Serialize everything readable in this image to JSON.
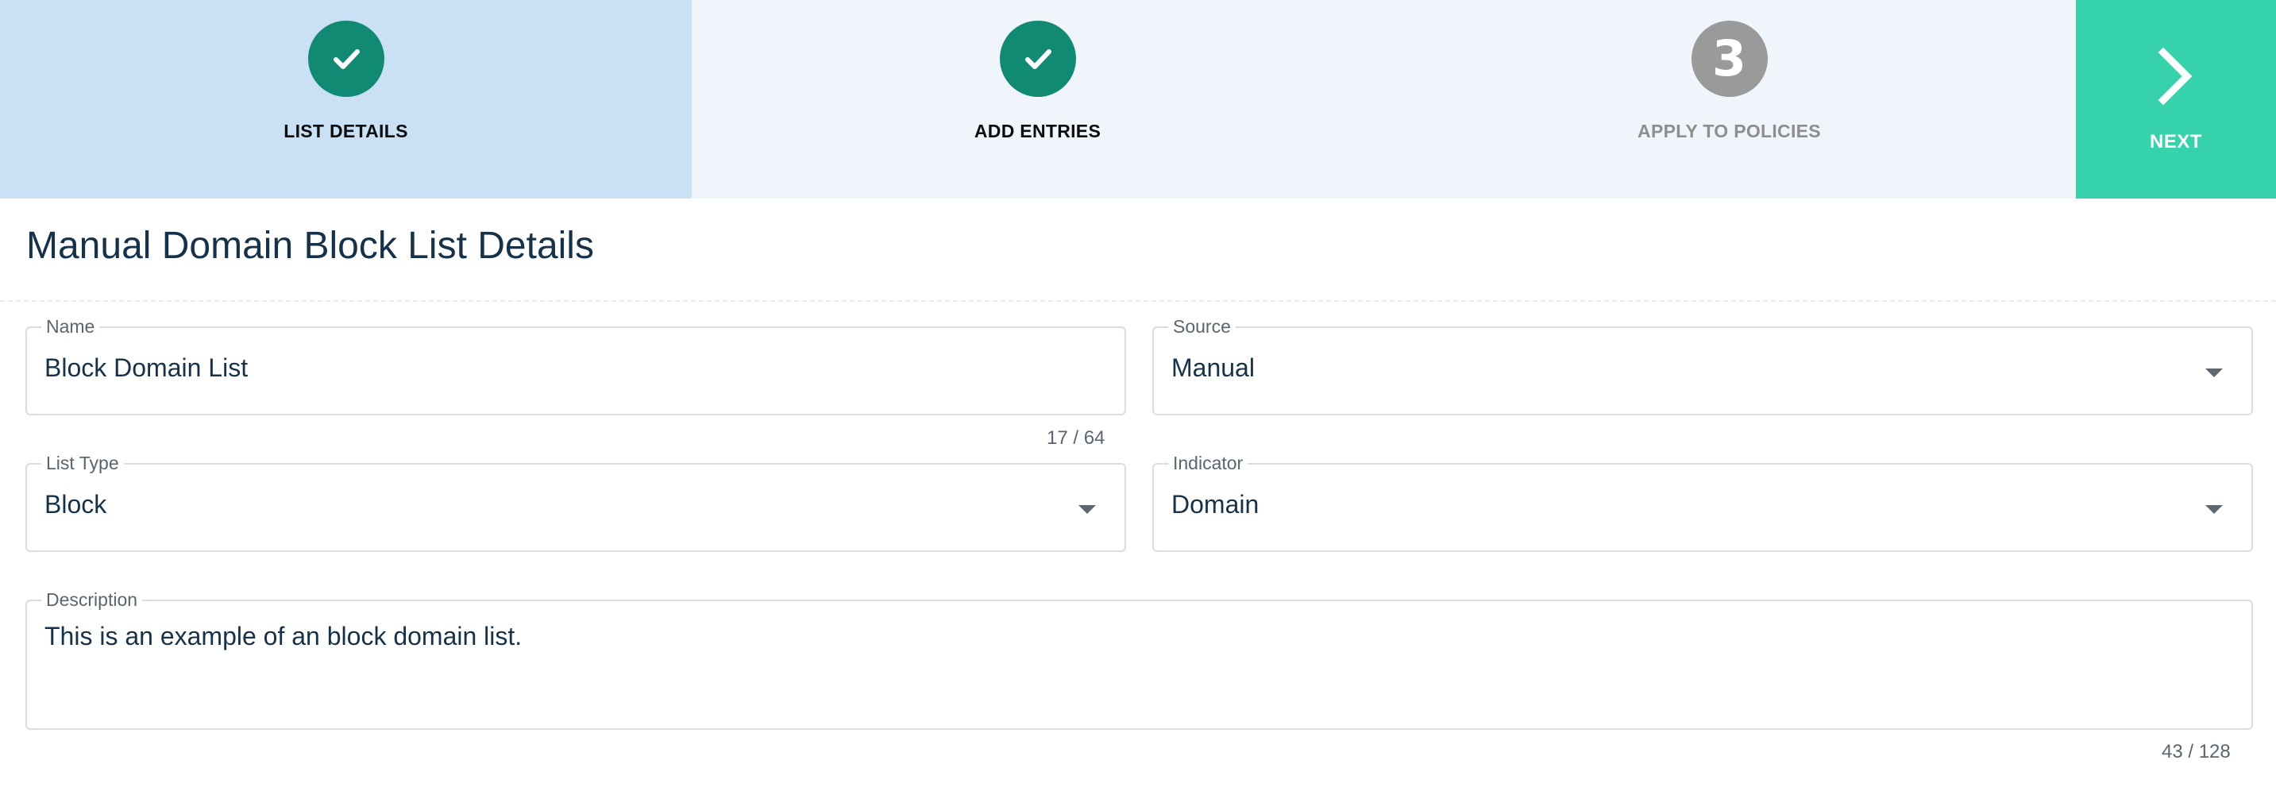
{
  "stepper": {
    "steps": [
      {
        "label": "LIST DETAILS",
        "status": "complete",
        "icon": "check-icon"
      },
      {
        "label": "ADD ENTRIES",
        "status": "complete",
        "icon": "check-icon"
      },
      {
        "label": "APPLY TO POLICIES",
        "status": "pending",
        "number": "3"
      }
    ],
    "next": {
      "label": "NEXT",
      "icon": "chevron-right-icon"
    }
  },
  "page": {
    "title": "Manual Domain Block List Details"
  },
  "form": {
    "name": {
      "label": "Name",
      "value": "Block Domain List",
      "counter": "17 / 64"
    },
    "source": {
      "label": "Source",
      "value": "Manual"
    },
    "list_type": {
      "label": "List Type",
      "value": "Block"
    },
    "indicator": {
      "label": "Indicator",
      "value": "Domain"
    },
    "description": {
      "label": "Description",
      "value": "This is an example of an block domain list.",
      "counter": "43 / 128"
    }
  },
  "colors": {
    "active_step_bg": "#c9e0f5",
    "step_bg": "#eff5fa",
    "complete": "#108a72",
    "pending": "#9a9a9a",
    "next_bg": "#36d2ac"
  }
}
